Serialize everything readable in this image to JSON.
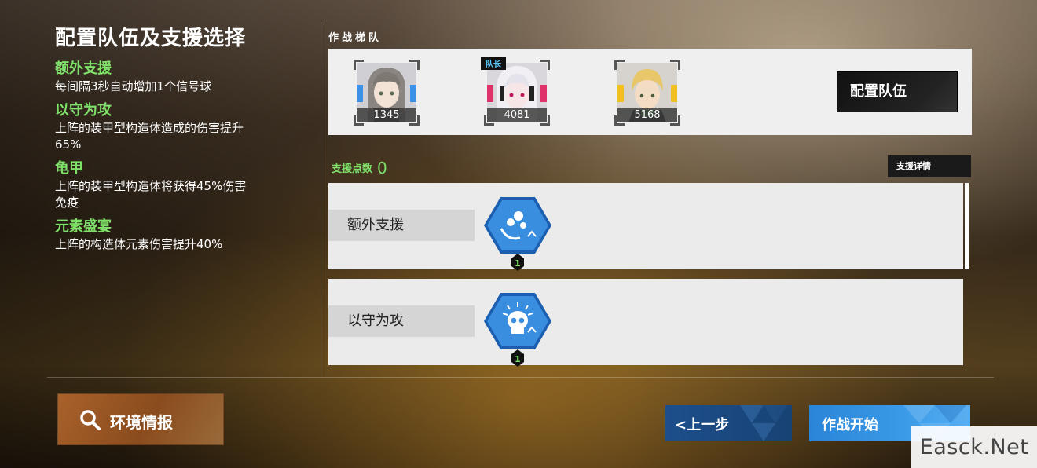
{
  "page_title": "配置队伍及支援选择",
  "effects": [
    {
      "name": "额外支援",
      "desc_lines": [
        "每间隔3秒自动增加1个信号球"
      ]
    },
    {
      "name": "以守为攻",
      "desc_lines": [
        "上阵的装甲型构造体造成的伤害提升",
        "65%"
      ]
    },
    {
      "name": "龟甲",
      "desc_lines": [
        "上阵的装甲型构造体将获得45%伤害",
        "免疫"
      ]
    },
    {
      "name": "元素盛宴",
      "desc_lines": [
        "上阵的构造体元素伤害提升40%"
      ]
    }
  ],
  "team": {
    "label": "作战梯队",
    "members": [
      {
        "power": "1345",
        "icon": "character-portrait-grey-hair"
      },
      {
        "power": "4081",
        "icon": "character-portrait-white-hair",
        "tag": "队长"
      },
      {
        "power": "5168",
        "icon": "character-portrait-blond-hair"
      }
    ],
    "config_button": "配置队伍"
  },
  "support": {
    "points_label": "支援点数",
    "points_value": "0",
    "detail_button": "支援详情",
    "cards": [
      {
        "label": "额外支援",
        "level": "1",
        "icon": "extra-support-icon"
      },
      {
        "label": "以守为攻",
        "level": "1",
        "icon": "skull-defense-icon"
      }
    ]
  },
  "bottom": {
    "env_button": "环境情报",
    "back_button": "上一步",
    "start_button": "作战开始"
  },
  "watermark": "Easck.Net",
  "colors": {
    "accent_green": "#7fe06a",
    "hex_blue": "#2f7fd6",
    "start_blue": "#3b9be8",
    "back_blue": "#1d4f8c",
    "env_orange": "#a9612a"
  }
}
